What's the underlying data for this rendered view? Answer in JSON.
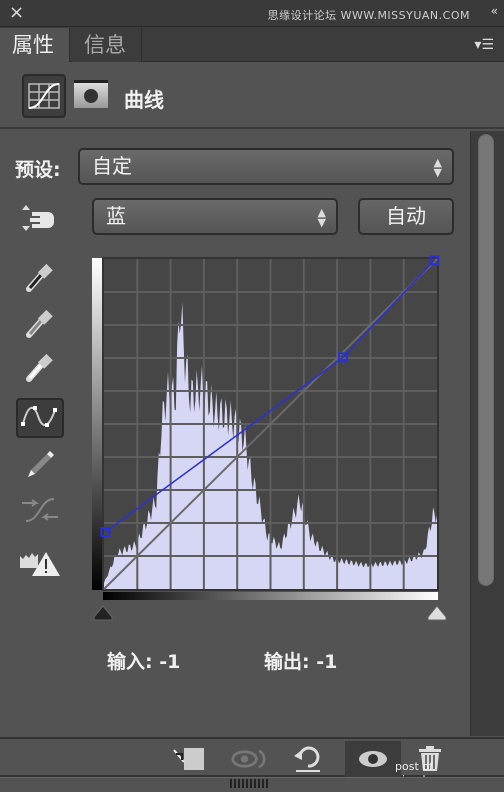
{
  "titlebar": {
    "close_icon": "×",
    "watermark": "思缘设计论坛 WWW.MISSYUAN.COM",
    "collapse_icon": "«"
  },
  "tabs": [
    {
      "label": "属性",
      "active": true
    },
    {
      "label": "信息",
      "active": false
    }
  ],
  "panel_menu_icon": "▾☰",
  "header": {
    "title": "曲线"
  },
  "preset": {
    "label": "预设:",
    "value": "自定"
  },
  "channel": {
    "value": "蓝"
  },
  "auto_button": "自动",
  "tools": [
    "black-point-eyedropper",
    "gray-point-eyedropper",
    "white-point-eyedropper",
    "curve-point-tool",
    "pencil-tool",
    "smooth-tool",
    "clipping-warning"
  ],
  "curve": {
    "channel_color": "#2a2fd8",
    "histogram_color": "#d6d6f5",
    "grid_divisions": 10,
    "points": [
      [
        1,
        44
      ],
      [
        183,
        179
      ],
      [
        253,
        254
      ]
    ],
    "range": [
      0,
      255
    ]
  },
  "readout": {
    "input": "输入: -1",
    "output": "输出: -1"
  },
  "footer": {
    "watermark": "post of uimaker.com"
  }
}
